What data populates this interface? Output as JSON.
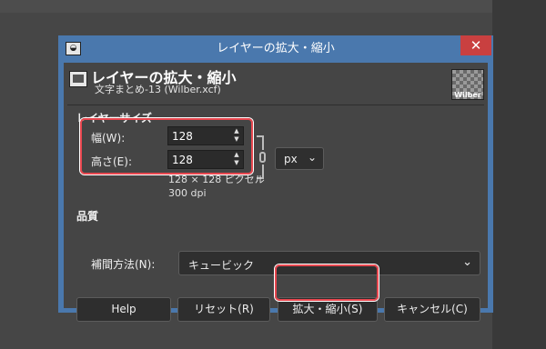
{
  "window": {
    "title": "レイヤーの拡大・縮小",
    "close_glyph": "✕"
  },
  "header": {
    "title": "レイヤーの拡大・縮小",
    "subtitle": "文字まとめ-13 (Wilber.xcf)",
    "thumb_text": "Wilber"
  },
  "layer_size": {
    "section_title": "レイヤーサイズ",
    "width_label": "幅(W):",
    "width_value": "128",
    "height_label": "高さ(E):",
    "height_value": "128",
    "unit": "px",
    "pixel_info": "128 × 128 ピクセル",
    "dpi_info": "300 dpi"
  },
  "quality": {
    "section_title": "品質",
    "interp_label": "補間方法(N):",
    "interp_value": "キュービック"
  },
  "buttons": {
    "help": "Help",
    "reset": "リセット(R)",
    "scale": "拡大・縮小(S)",
    "cancel": "キャンセル(C)"
  },
  "colors": {
    "titlebar": "#4a78ad",
    "dialog_bg": "#454545",
    "close": "#c94040",
    "highlight": "#e8474f"
  }
}
